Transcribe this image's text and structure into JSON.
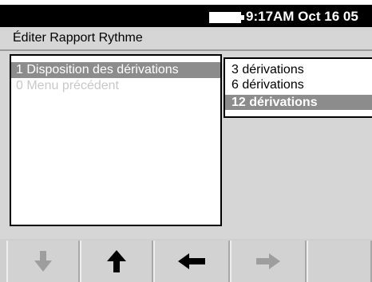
{
  "status": {
    "time_date": "9:17AM Oct 16 05",
    "battery_icon": "battery-icon"
  },
  "header": {
    "title": "Éditer Rapport Rythme"
  },
  "menu": {
    "items": [
      {
        "label": "1 Disposition des dérivations",
        "state": "selected"
      },
      {
        "label": "0 Menu précédent",
        "state": "dimmed"
      }
    ]
  },
  "options": {
    "items": [
      {
        "label": "3 dérivations",
        "selected": false
      },
      {
        "label": "6 dérivations",
        "selected": false
      },
      {
        "label": "12 dérivations",
        "selected": true
      }
    ]
  },
  "softkeys": [
    {
      "icon": "arrow-down-icon",
      "enabled": false
    },
    {
      "icon": "arrow-up-icon",
      "enabled": true
    },
    {
      "icon": "arrow-left-icon",
      "enabled": true
    },
    {
      "icon": "arrow-right-icon",
      "enabled": false
    },
    {
      "icon": "blank",
      "enabled": false
    }
  ],
  "colors": {
    "background": "#d6d6d6",
    "statusbar": "#000000",
    "highlight": "#8c8c8c",
    "disabled_icon": "#9e9e9e"
  }
}
